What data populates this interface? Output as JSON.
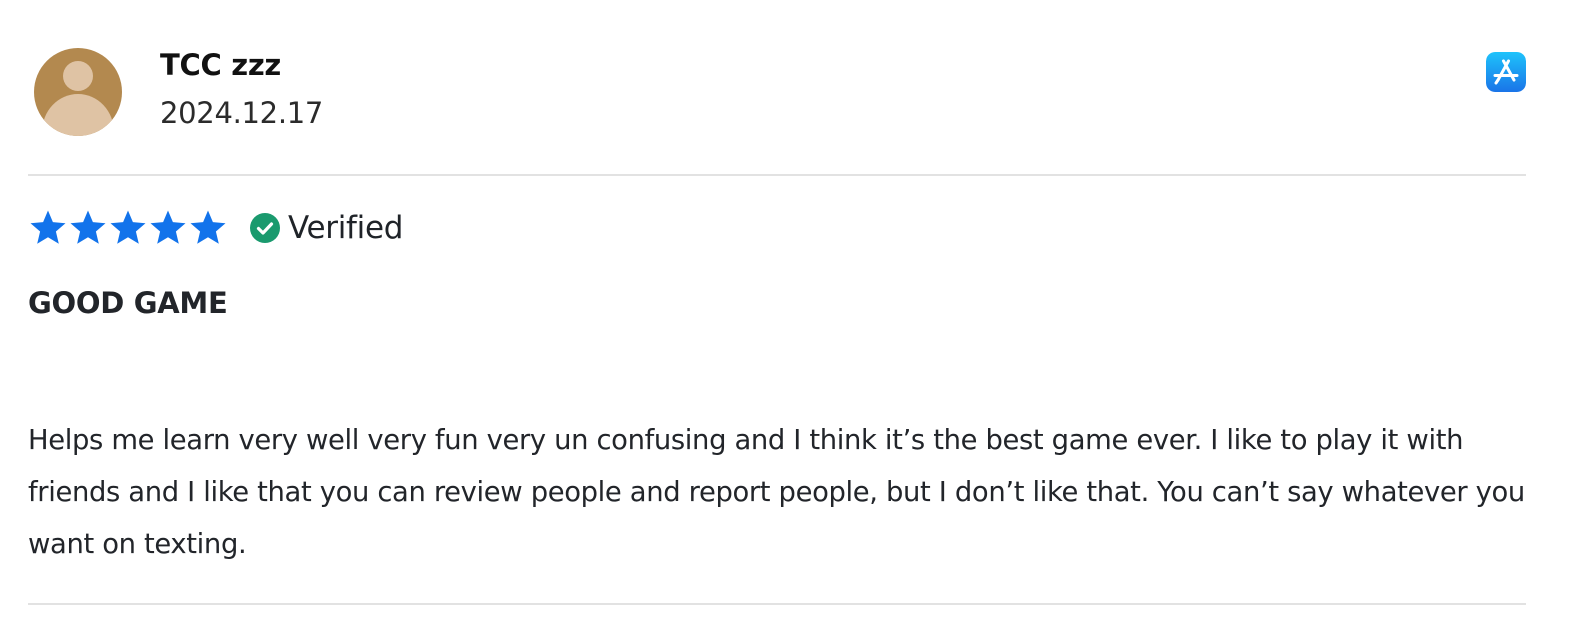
{
  "review": {
    "reviewer_name": "TCC zzz",
    "date": "2024.12.17",
    "rating": 5,
    "rating_max": 5,
    "verified_label": "Verified",
    "title": "GOOD GAME",
    "body": "Helps me learn very well very fun very un confusing and I think it’s the best game ever. I like to play it with friends and I like that you can review people and report people, but I don’t like that. You can’t say whatever you want on texting."
  },
  "icons": {
    "avatar": "user-avatar-placeholder-icon",
    "store": "app-store-icon",
    "star": "star-icon",
    "verified": "check-circle-icon"
  },
  "colors": {
    "star": "#1273eb",
    "verified": "#1a9a6e",
    "avatar_bg": "#b3894f",
    "avatar_figure": "#dfc3a4",
    "store_gradient_top": "#1ec3fb",
    "store_gradient_bottom": "#1a74e8",
    "divider": "#e2e2e2",
    "text": "#22252a"
  }
}
